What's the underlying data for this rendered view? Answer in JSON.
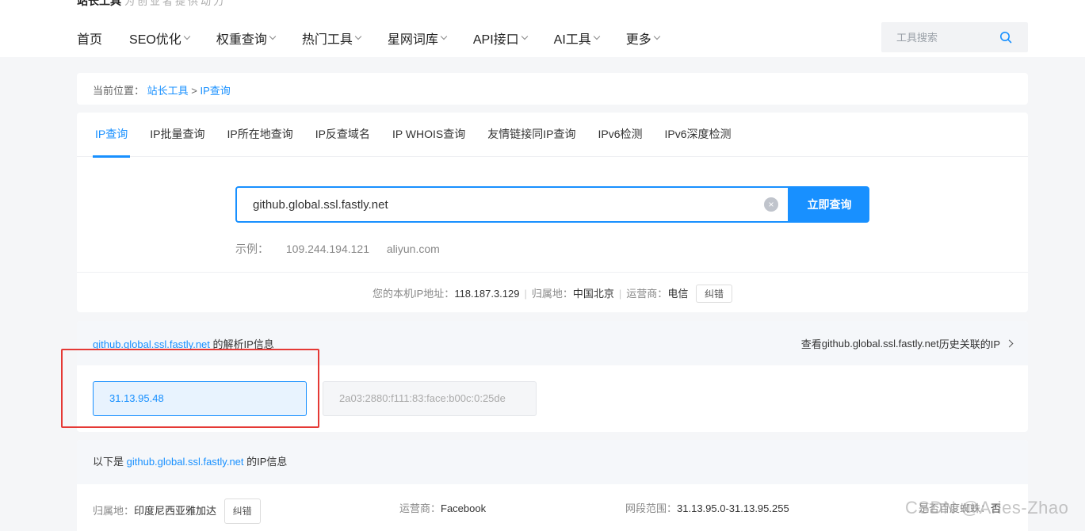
{
  "header": {
    "brand": "站长工具",
    "slogan": "为创业者提供动力",
    "nav": [
      {
        "label": "首页",
        "has_dropdown": false
      },
      {
        "label": "SEO优化",
        "has_dropdown": true
      },
      {
        "label": "权重查询",
        "has_dropdown": true
      },
      {
        "label": "热门工具",
        "has_dropdown": true
      },
      {
        "label": "星网词库",
        "has_dropdown": true
      },
      {
        "label": "API接口",
        "has_dropdown": true
      },
      {
        "label": "AI工具",
        "has_dropdown": true
      },
      {
        "label": "更多",
        "has_dropdown": true
      }
    ],
    "search_placeholder": "工具搜索"
  },
  "breadcrumb": {
    "prefix": "当前位置：",
    "root": "站长工具",
    "separator": ">",
    "current": "IP查询"
  },
  "tabs": [
    "IP查询",
    "IP批量查询",
    "IP所在地查询",
    "IP反查域名",
    "IP WHOIS查询",
    "友情链接同IP查询",
    "IPv6检测",
    "IPv6深度检测"
  ],
  "active_tab": 0,
  "query": {
    "value": "github.global.ssl.fastly.net",
    "clear_icon": "×",
    "button_label": "立即查询",
    "example_label": "示例：",
    "examples": [
      "109.244.194.121",
      "aliyun.com"
    ]
  },
  "local_ip": {
    "ip_label": "您的本机IP地址：",
    "ip": "118.187.3.129",
    "region_label": "归属地：",
    "region": "中国北京",
    "isp_label": "运营商：",
    "isp": "电信",
    "separator": "|",
    "fix_label": "纠错"
  },
  "resolve": {
    "domain": "github.global.ssl.fastly.net",
    "suffix": " 的解析IP信息",
    "history_prefix": "查看 ",
    "history_domain": "github.global.ssl.fastly.net",
    "history_suffix": " 历史关联的IP",
    "ips": [
      "31.13.95.48",
      "2a03:2880:f111:83:face:b00c:0:25de"
    ],
    "selected_ip": 0
  },
  "info": {
    "prefix": "以下是 ",
    "domain": "github.global.ssl.fastly.net",
    "suffix": " 的IP信息",
    "region_label": "归属地：",
    "region": "印度尼西亚雅加达",
    "fix_label": "纠错",
    "isp_label": "运营商：",
    "isp": "Facebook",
    "range_label": "网段范围：",
    "range": "31.13.95.0-31.13.95.255",
    "baidu_label": "是否百度蜘蛛：",
    "baidu": "否"
  },
  "watermark": "CSDN @Aries-Zhao",
  "colors": {
    "accent": "#1890ff",
    "highlight_border": "#e53935",
    "page_bg": "#f5f6f8"
  }
}
